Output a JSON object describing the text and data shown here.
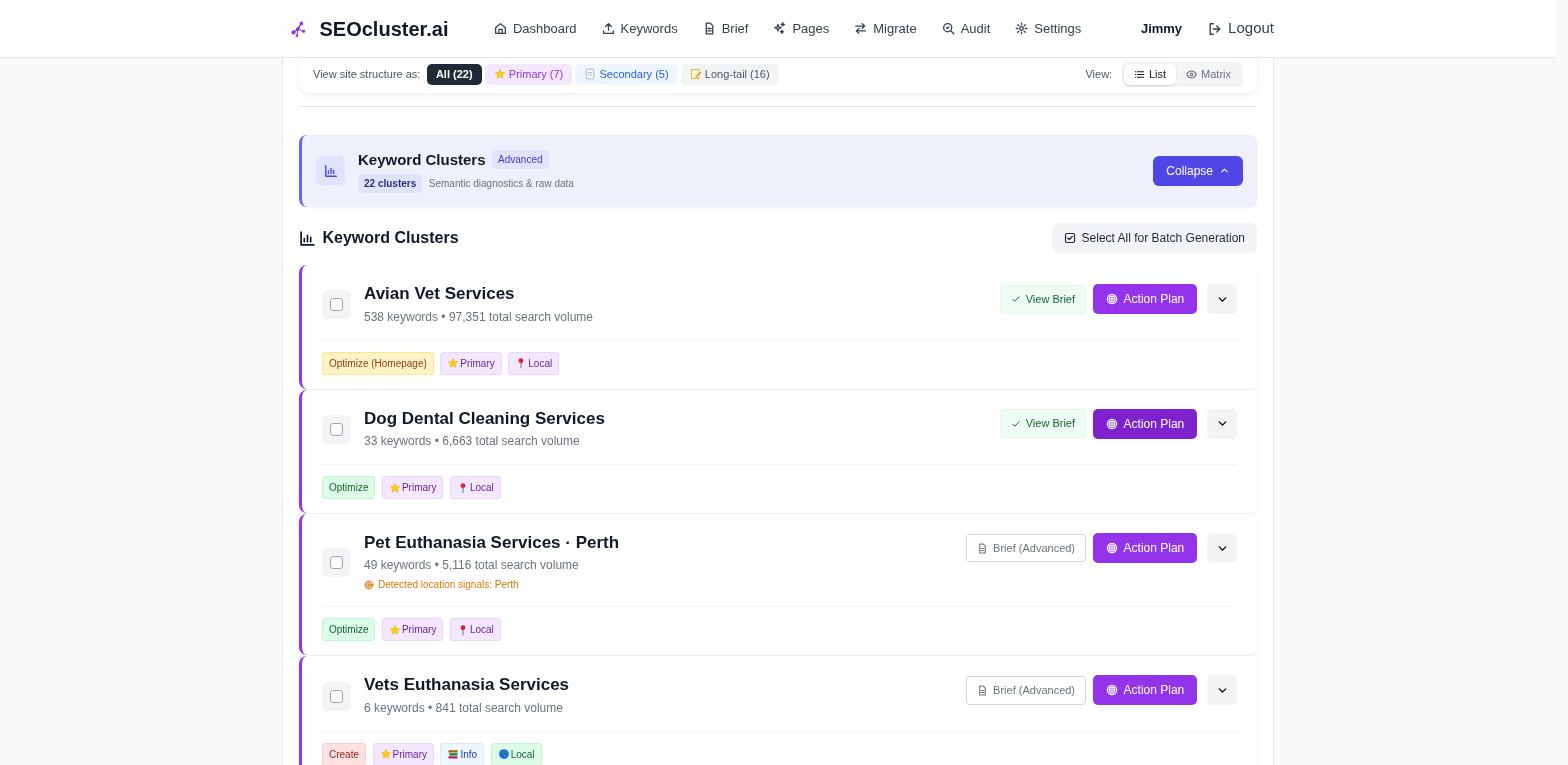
{
  "navbar": {
    "brand": "SEOcluster.ai",
    "items": [
      {
        "label": "Dashboard"
      },
      {
        "label": "Keywords"
      },
      {
        "label": "Brief"
      },
      {
        "label": "Pages"
      },
      {
        "label": "Migrate"
      },
      {
        "label": "Audit"
      },
      {
        "label": "Settings"
      }
    ],
    "user": "Jimmy",
    "logout": "Logout"
  },
  "structure_bar": {
    "label": "View site structure as:",
    "filters": [
      {
        "label": "All (22)",
        "kind": "all",
        "selected": true
      },
      {
        "label": "Primary (7)",
        "kind": "primary",
        "selected": false
      },
      {
        "label": "Secondary (5)",
        "kind": "secondary",
        "selected": false
      },
      {
        "label": "Long-tail (16)",
        "kind": "longtail",
        "selected": false
      }
    ],
    "view_label": "View:",
    "views": [
      {
        "label": "List",
        "selected": true
      },
      {
        "label": "Matrix",
        "selected": false
      }
    ]
  },
  "advanced_panel": {
    "title": "Keyword Clusters",
    "badge": "Advanced",
    "count": "22 clusters",
    "subtitle": "Semantic diagnostics & raw data",
    "button": "Collapse"
  },
  "section": {
    "title": "Keyword Clusters",
    "select_all": "Select All for Batch Generation"
  },
  "clusters": [
    {
      "title": "Avian Vet Services",
      "meta": "538 keywords • 97,351 total search volume",
      "checked": false,
      "brief": {
        "kind": "view",
        "label": "View Brief"
      },
      "action": "Action Plan",
      "highlighted": false,
      "tags": [
        {
          "label": "Optimize (Homepage)",
          "kind": "homepage"
        },
        {
          "label": "Primary",
          "kind": "primary"
        },
        {
          "label": "Local",
          "kind": "local"
        }
      ]
    },
    {
      "title": "Dog Dental Cleaning Services",
      "meta": "33 keywords • 6,663 total search volume",
      "checked": false,
      "brief": {
        "kind": "view",
        "label": "View Brief"
      },
      "action": "Action Plan",
      "highlighted": true,
      "tags": [
        {
          "label": "Optimize",
          "kind": "optimize"
        },
        {
          "label": "Primary",
          "kind": "primary"
        },
        {
          "label": "Local",
          "kind": "local"
        }
      ]
    },
    {
      "title": "Pet Euthanasia Services · Perth",
      "meta": "49 keywords • 5,116 total search volume",
      "location": "Detected location signals: Perth",
      "checked": false,
      "brief": {
        "kind": "advanced",
        "label": "Brief (Advanced)"
      },
      "action": "Action Plan",
      "highlighted": false,
      "tags": [
        {
          "label": "Optimize",
          "kind": "optimize"
        },
        {
          "label": "Primary",
          "kind": "primary"
        },
        {
          "label": "Local",
          "kind": "local"
        }
      ]
    },
    {
      "title": "Vets Euthanasia Services",
      "meta": "6 keywords • 841 total search volume",
      "checked": false,
      "brief": {
        "kind": "advanced",
        "label": "Brief (Advanced)"
      },
      "action": "Action Plan",
      "highlighted": false,
      "tags": [
        {
          "label": "Create",
          "kind": "create"
        },
        {
          "label": "Primary",
          "kind": "primary"
        },
        {
          "label": "Info",
          "kind": "info"
        },
        {
          "label": "Local",
          "kind": "regional"
        }
      ]
    }
  ]
}
